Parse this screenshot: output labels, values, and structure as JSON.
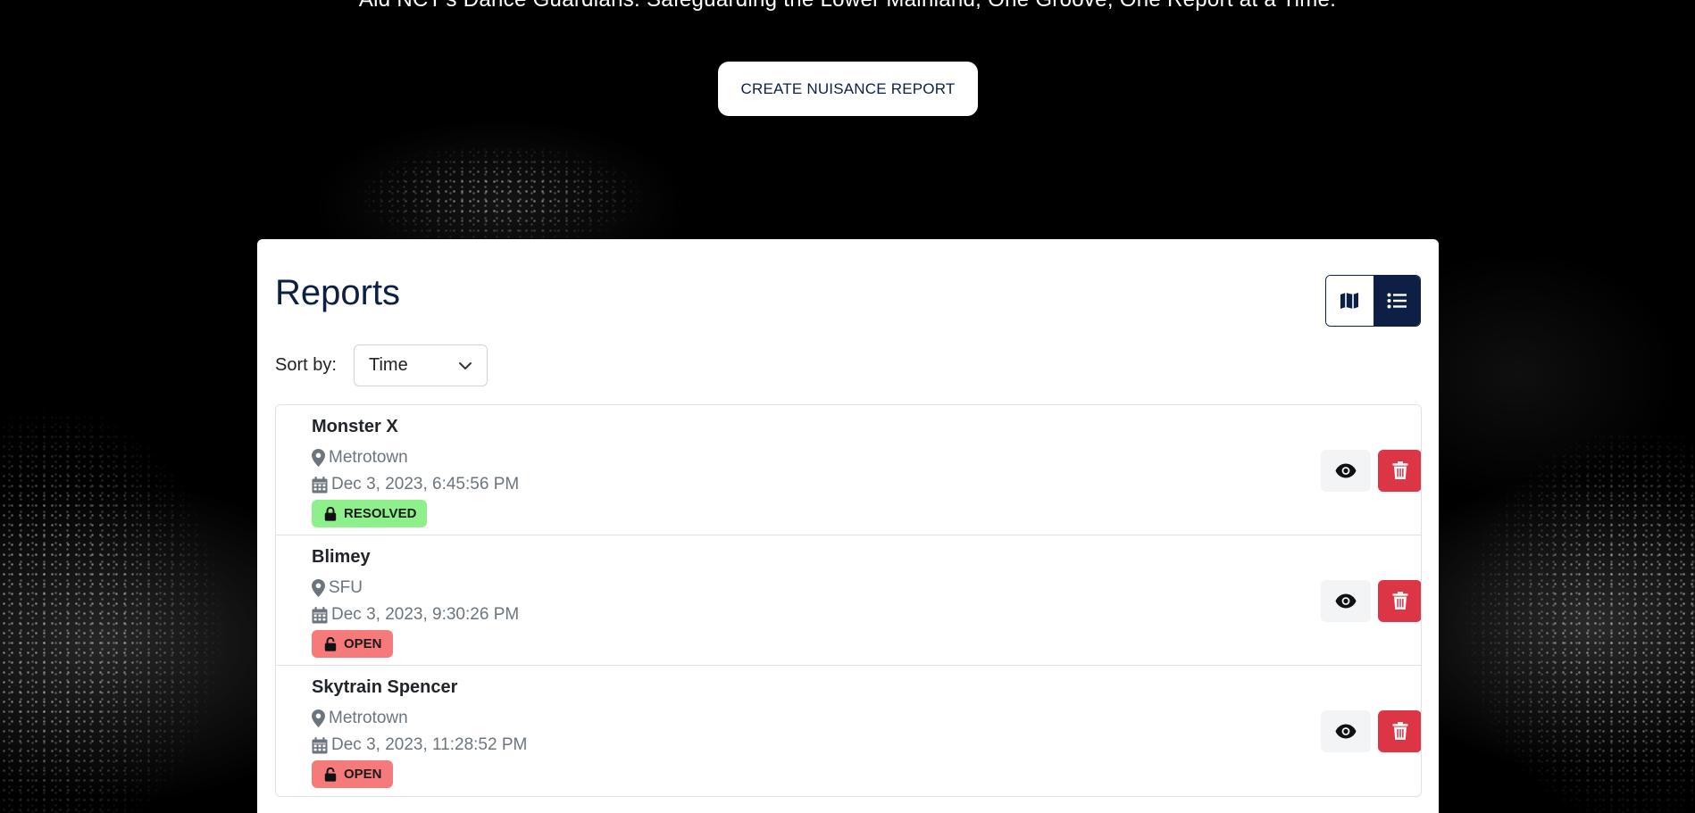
{
  "hero": {
    "tagline": "Aid NCT's Dance Guardians: Safeguarding the Lower Mainland, One Groove, One Report at a Time.",
    "cta_label": "CREATE NUISANCE REPORT"
  },
  "reports_panel": {
    "title": "Reports",
    "view_toggle": {
      "options": [
        {
          "icon": "map-icon",
          "active": false
        },
        {
          "icon": "list-icon",
          "active": true
        }
      ]
    },
    "sort": {
      "label": "Sort by:",
      "selected": "Time"
    },
    "items": [
      {
        "title": "Monster X",
        "location": "Metrotown",
        "datetime": "Dec 3, 2023, 6:45:56 PM",
        "status": "RESOLVED",
        "status_icon": "lock-icon",
        "status_color": "#8ef08a"
      },
      {
        "title": "Blimey",
        "location": "SFU",
        "datetime": "Dec 3, 2023, 9:30:26 PM",
        "status": "OPEN",
        "status_icon": "unlock-icon",
        "status_color": "#f77a7a"
      },
      {
        "title": "Skytrain Spencer",
        "location": "Metrotown",
        "datetime": "Dec 3, 2023, 11:28:52 PM",
        "status": "OPEN",
        "status_icon": "unlock-icon",
        "status_color": "#f77a7a"
      }
    ]
  },
  "colors": {
    "navy": "#0d1f45",
    "danger": "#dc3545",
    "muted_text": "#6c757d"
  }
}
